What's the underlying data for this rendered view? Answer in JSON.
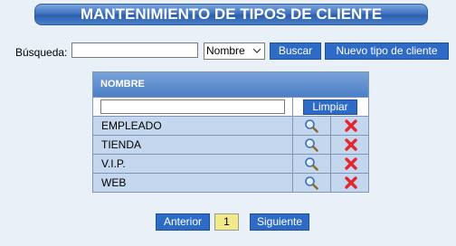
{
  "header": {
    "title": "MANTENIMIENTO DE TIPOS DE CLIENTE"
  },
  "search": {
    "label": "Búsqueda:",
    "value": "",
    "select_value": "Nombre",
    "search_button": "Buscar",
    "new_button": "Nuevo tipo de cliente"
  },
  "grid": {
    "column_header": "NOMBRE",
    "filter_value": "",
    "clear_button": "Limpiar",
    "rows": [
      {
        "name": "EMPLEADO"
      },
      {
        "name": "TIENDA"
      },
      {
        "name": "V.I.P."
      },
      {
        "name": "WEB"
      }
    ]
  },
  "pager": {
    "prev": "Anterior",
    "current": "1",
    "next": "Siguiente"
  },
  "colors": {
    "accent": "#2e6bc6",
    "row_bg": "#c5d7ef",
    "page_bg": "#eaf0f8",
    "page_num_bg": "#f2e98a",
    "delete_red": "#e0282e"
  },
  "icons": {
    "view": "magnifier-icon",
    "delete": "delete-x-icon",
    "dropdown": "chevron-down-icon"
  }
}
